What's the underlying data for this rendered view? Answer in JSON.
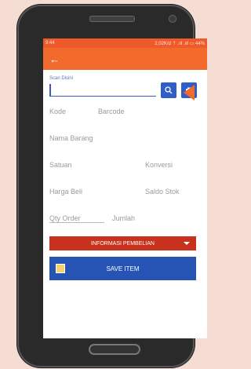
{
  "status": {
    "time": "9:44",
    "right": "2,02K/d ⇡ .ıll .ıll ▭ 44%"
  },
  "appbar": {
    "back_icon": "arrow-left"
  },
  "form": {
    "scan_label": "Scan Disini",
    "scan_value": "",
    "kode": "Kode",
    "barcode": "Barcode",
    "nama_barang": "Nama Barang",
    "satuan": "Satuan",
    "konversi": "Konversi",
    "harga_beli": "Harga Beli",
    "saldo_stok": "Saldo Stok",
    "qty_order": "Qty Order",
    "jumlah": "Jumlah",
    "informasi_pembelian": "INFORMASI PEMBELIAN",
    "save_item": "SAVE ITEM"
  },
  "colors": {
    "accent": "#f26b2d",
    "primary": "#2f5ec8",
    "danger": "#c8321c"
  }
}
